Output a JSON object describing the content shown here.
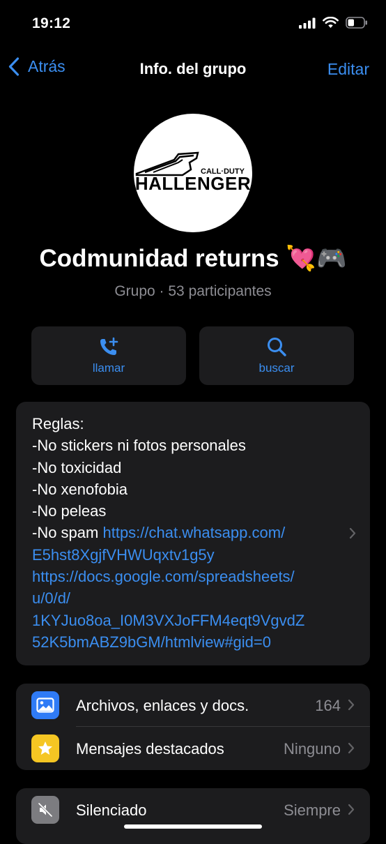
{
  "status_bar": {
    "time": "19:12",
    "battery_level_percent": 35
  },
  "nav": {
    "back_label": "Atrás",
    "title": "Info. del grupo",
    "edit_label": "Editar"
  },
  "group": {
    "name": "Codmunidad returns 💘🎮",
    "subtitle": "Grupo · 53 participantes",
    "avatar_text_top": "CALL·DUTY",
    "avatar_text_main": "HALLENGER"
  },
  "actions": [
    {
      "label": "llamar",
      "icon": "phone-plus-icon"
    },
    {
      "label": "buscar",
      "icon": "search-icon"
    }
  ],
  "description": {
    "lines": [
      "Reglas:",
      "-No stickers ni fotos personales",
      "-No toxicidad",
      "-No xenofobia",
      "-No peleas"
    ],
    "spam_prefix": "-No spam ",
    "link1_part1": "https://chat.whatsapp.com/",
    "link1_part2": "E5hst8XgjfVHWUqxtv1g5y",
    "link2_part1": "https://docs.google.com/spreadsheets/",
    "link2_part2": "u/0/d/",
    "link2_part3": "1KYJuo8oa_I0M3VXJoFFM4eqt9VgvdZ",
    "link2_part4": "52K5bmABZ9bGM/htmlview#gid=0"
  },
  "list1": [
    {
      "label": "Archivos, enlaces y docs.",
      "value": "164",
      "icon": "photo-icon",
      "color": "#2f7bf6"
    },
    {
      "label": "Mensajes destacados",
      "value": "Ninguno",
      "icon": "star-icon",
      "color": "#f5c623"
    }
  ],
  "list2": [
    {
      "label": "Silenciado",
      "value": "Siempre",
      "icon": "speaker-muted-icon",
      "color": "#7c7c80"
    }
  ],
  "colors": {
    "accent": "#3b8ef0",
    "card": "#1c1c1e",
    "secondary_text": "#8d8d93"
  }
}
